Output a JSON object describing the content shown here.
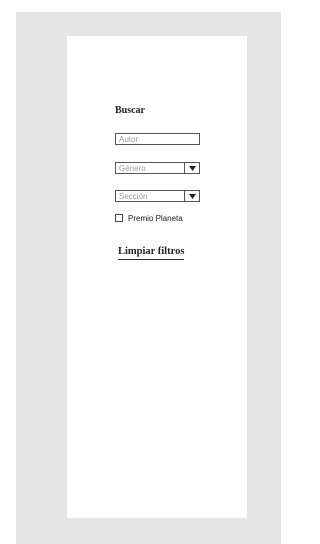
{
  "filters": {
    "title": "Buscar",
    "autor": {
      "placeholder": "Autor"
    },
    "genero": {
      "selected": "Género"
    },
    "seccion": {
      "selected": "Sección"
    },
    "premio": {
      "label": "Premio Planeta",
      "checked": false
    },
    "clear_label": "Limpiar filtros"
  },
  "icons": {
    "dropdown": "chevron-down-icon"
  }
}
